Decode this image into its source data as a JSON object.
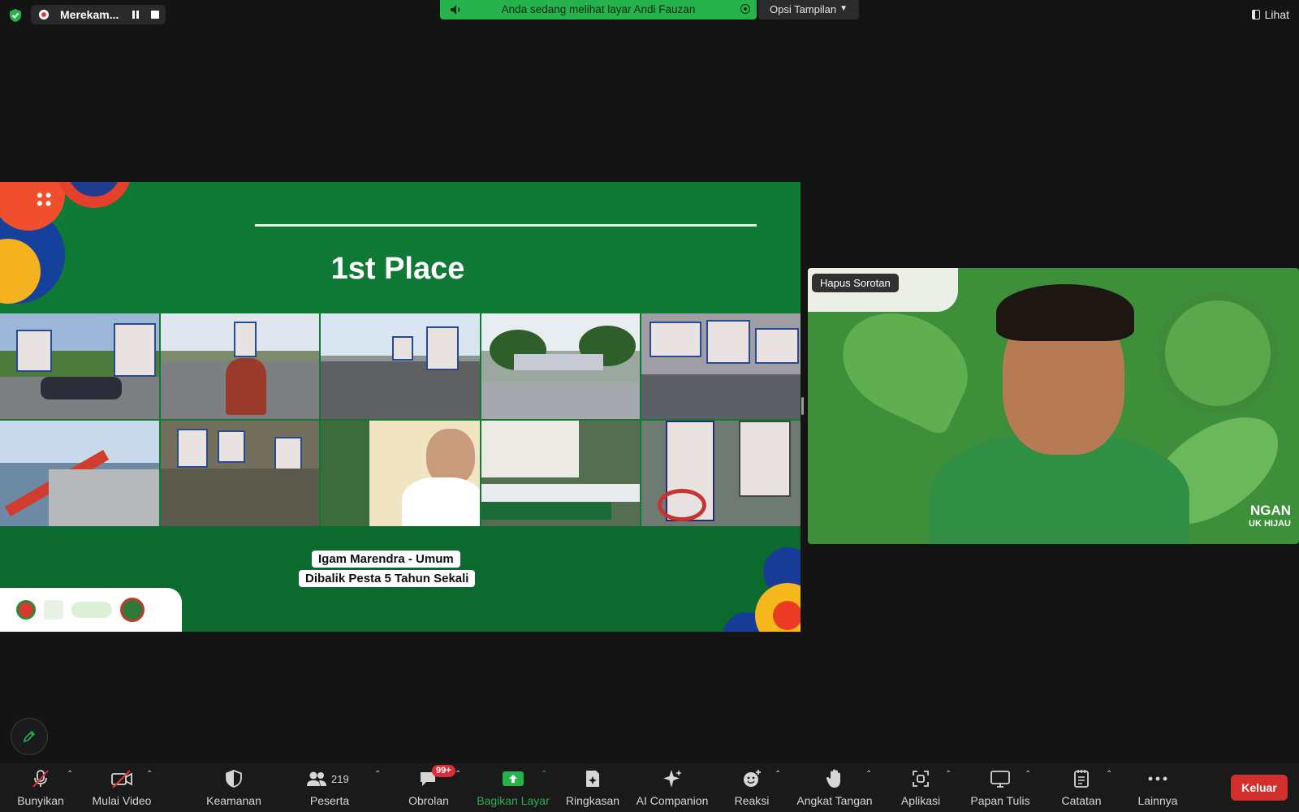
{
  "top_bar": {
    "recording_label": "Merekam...",
    "share_banner_text": "Anda sedang melihat layar Andi Fauzan",
    "view_options_label": "Opsi Tampilan",
    "view_button_label": "Lihat"
  },
  "slide": {
    "title": "1st Place",
    "caption_line1": "Igam Marendra - Umum",
    "caption_line2": "Dibalik Pesta 5 Tahun Sekali"
  },
  "video_tile": {
    "spotlight_button_label": "Hapus Sorotan",
    "background_text_line1": "NGAN",
    "background_text_line2": "UK HIJAU"
  },
  "toolbar": {
    "items": [
      {
        "label": "Bunyikan",
        "icon": "microphone-muted-icon"
      },
      {
        "label": "Mulai Video",
        "icon": "video-off-icon"
      },
      {
        "label": "Keamanan",
        "icon": "shield-icon"
      },
      {
        "label": "Peserta",
        "icon": "participants-icon",
        "count": "219"
      },
      {
        "label": "Obrolan",
        "icon": "chat-icon",
        "badge": "99+"
      },
      {
        "label": "Bagikan Layar",
        "icon": "share-screen-icon"
      },
      {
        "label": "Ringkasan",
        "icon": "summary-icon"
      },
      {
        "label": "AI Companion",
        "icon": "sparkle-icon"
      },
      {
        "label": "Reaksi",
        "icon": "emoji-icon"
      },
      {
        "label": "Angkat Tangan",
        "icon": "raise-hand-icon"
      },
      {
        "label": "Aplikasi",
        "icon": "apps-icon"
      },
      {
        "label": "Papan Tulis",
        "icon": "whiteboard-icon"
      },
      {
        "label": "Catatan",
        "icon": "notes-icon"
      },
      {
        "label": "Lainnya",
        "icon": "more-icon"
      }
    ],
    "leave_label": "Keluar"
  },
  "colors": {
    "share_green": "#26b34d",
    "slide_green": "#0f7a36",
    "leave_red": "#d32f2f",
    "badge_red": "#e02d35"
  }
}
